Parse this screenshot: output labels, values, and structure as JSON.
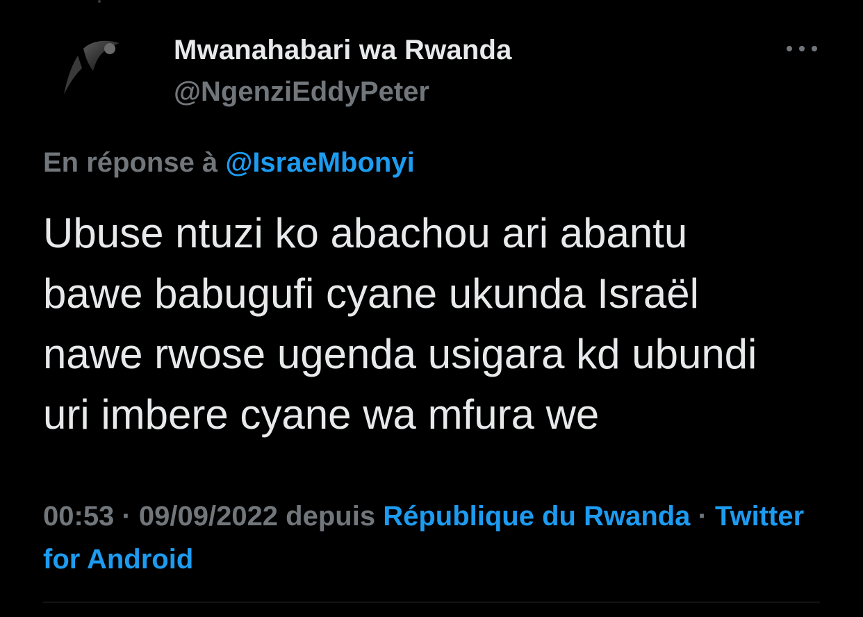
{
  "colors": {
    "background": "#000000",
    "primary_text": "#e7e9ea",
    "secondary_text": "#71767b",
    "accent": "#1d9bf0",
    "divider": "#2f3336"
  },
  "tweet": {
    "author": {
      "display_name": "Mwanahabari wa Rwanda",
      "handle": "@NgenziEddyPeter",
      "avatar_icon": "user-avatar-photo"
    },
    "more_icon": "more-options-icon",
    "reply": {
      "prefix": "En réponse à ",
      "mention": "@IsraeMbonyi"
    },
    "text": "Ubuse ntuzi ko abachou ari abantu\nbawe babugufi cyane ukunda Israël\nnawe rwose ugenda usigara kd ubundi\nuri imbere cyane wa mfura we",
    "meta": {
      "time": "00:53",
      "separator": " · ",
      "date": "09/09/2022",
      "from_label": " depuis ",
      "location": "République du Rwanda",
      "separator2": " · ",
      "client": "Twitter for Android"
    }
  }
}
